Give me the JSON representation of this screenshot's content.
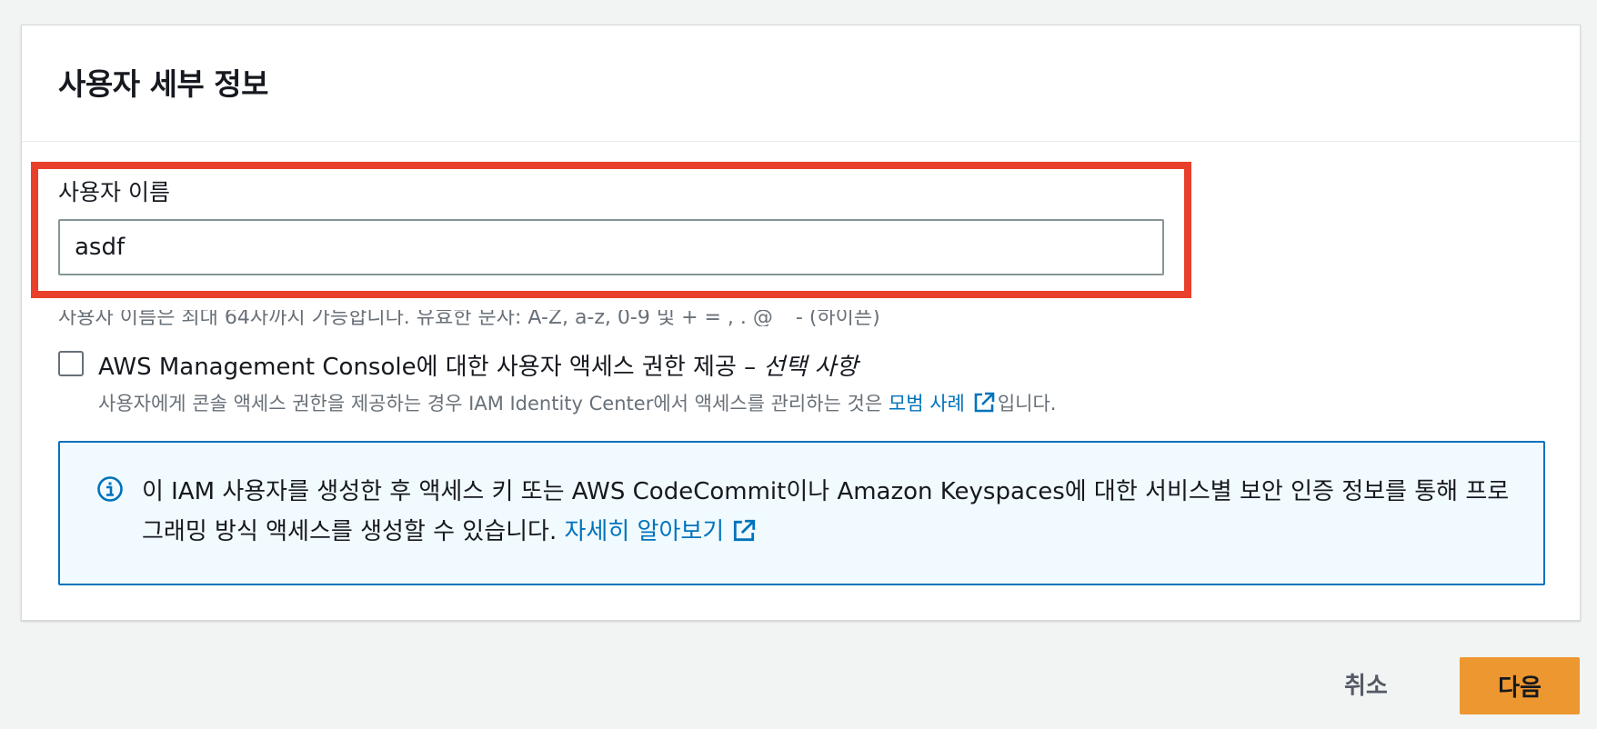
{
  "panel": {
    "title": "사용자 세부 정보"
  },
  "username_field": {
    "label": "사용자 이름",
    "value": "asdf",
    "hint": "사용자 이름은 최대 64자까지 가능합니다. 유효한 문자: A-Z, a-z, 0-9 및 + = , . @ _ - (하이픈)"
  },
  "console_access": {
    "checked": false,
    "label_main": "AWS Management Console에 대한 사용자 액세스 권한 제공 – ",
    "label_optional": "선택 사항",
    "description_prefix": "사용자에게 콘솔 액세스 권한을 제공하는 경우 IAM Identity Center에서 액세스를 관리하는 것은 ",
    "description_link": "모범 사례",
    "description_suffix": "입니다."
  },
  "info_alert": {
    "text": "이 IAM 사용자를 생성한 후 액세스 키 또는 AWS CodeCommit이나 Amazon Keyspaces에 대한 서비스별 보안 인증 정보를 통해 프로그래밍 방식 액세스를 생성할 수 있습니다. ",
    "link": "자세히 알아보기"
  },
  "footer": {
    "cancel_label": "취소",
    "next_label": "다음"
  },
  "colors": {
    "link": "#0073bb",
    "primary_button": "#ec9730",
    "highlight": "#e8402b",
    "info_bg": "#f1faff"
  }
}
